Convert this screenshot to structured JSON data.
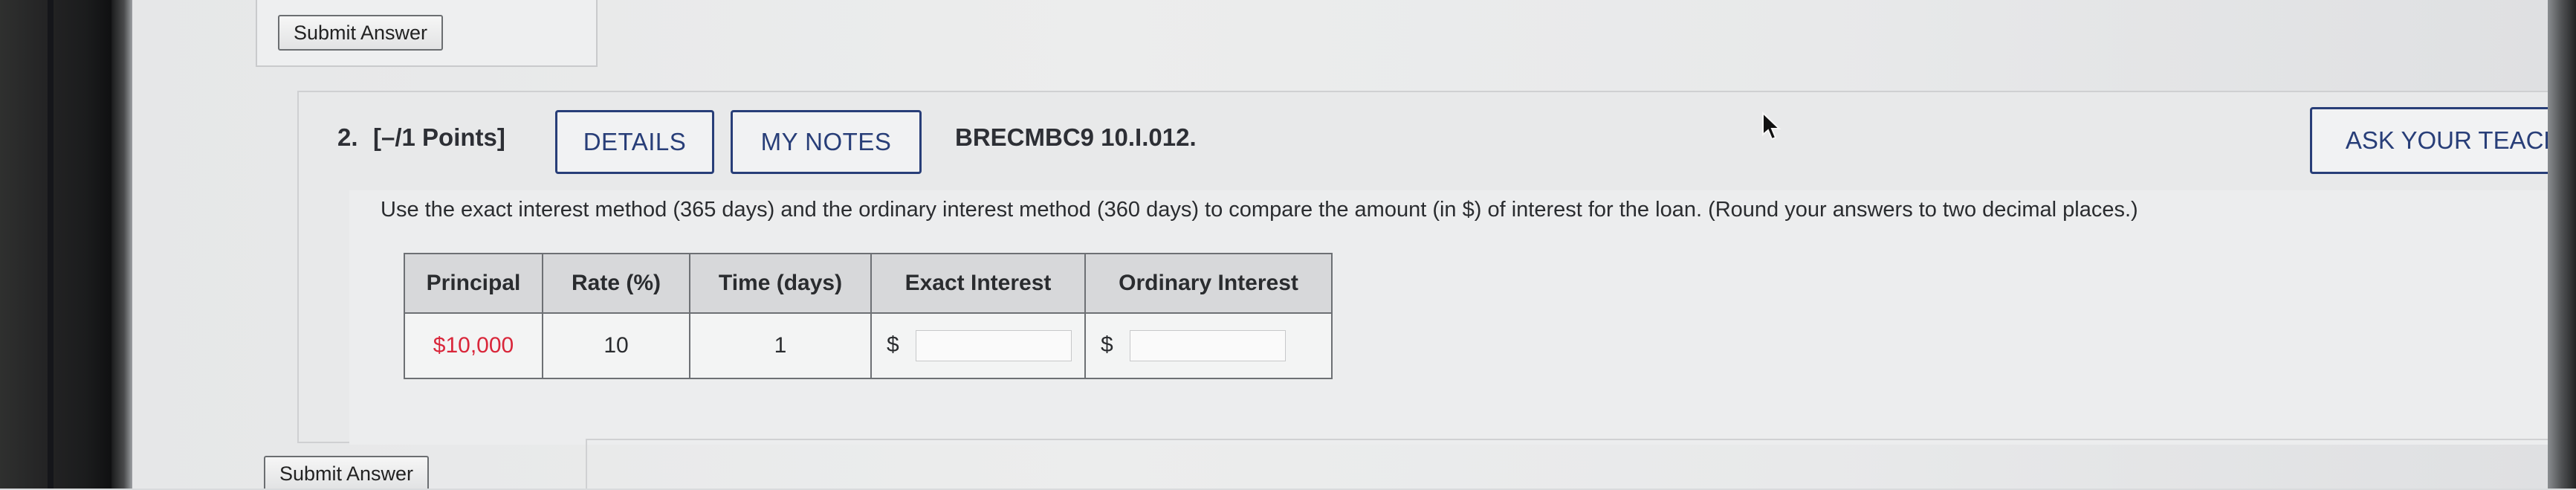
{
  "top": {
    "submit_label": "Submit Answer"
  },
  "question": {
    "number": "2.",
    "points": "[–/1 Points]",
    "details_label": "DETAILS",
    "notes_label": "MY NOTES",
    "code": "BRECMBC9 10.I.012.",
    "ask_label": "ASK YOUR TEACHER",
    "text": "Use the exact interest method (365 days) and the ordinary interest method (360 days) to compare the amount (in $) of interest for the loan. (Round your answers to two decimal places.)"
  },
  "table": {
    "headers": [
      "Principal",
      "Rate (%)",
      "Time (days)",
      "Exact Interest",
      "Ordinary Interest"
    ],
    "row": {
      "principal": "$10,000",
      "rate": "10",
      "time": "1",
      "exact_prefix": "$",
      "ordinary_prefix": "$",
      "exact_value": "",
      "ordinary_value": ""
    }
  },
  "bottom": {
    "submit_label": "Submit Answer"
  },
  "icons": {
    "cursor": "mouse-pointer-icon"
  },
  "colors": {
    "accent": "#283e78",
    "principal": "#d9263a"
  }
}
